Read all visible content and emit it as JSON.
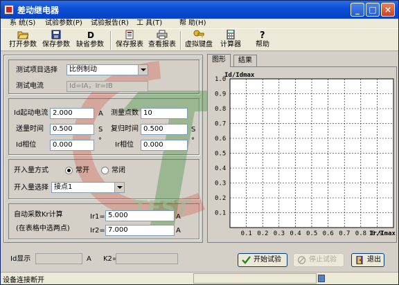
{
  "window": {
    "title": "差动继电器",
    "controls": {
      "minimize": "_",
      "maximize": "□",
      "close": "×"
    }
  },
  "menu": [
    {
      "label": "系 统(S)"
    },
    {
      "label": "试验参数(P)"
    },
    {
      "label": "试验报告(R)"
    },
    {
      "label": "工 具(T)"
    },
    {
      "label": "帮 助(H)"
    }
  ],
  "toolbar": [
    {
      "label": "打开参数",
      "icon": "folder-open-icon"
    },
    {
      "label": "保存参数",
      "icon": "save-icon"
    },
    {
      "label": "缺省参数",
      "icon": "default-icon"
    },
    {
      "label": "保存报表",
      "icon": "report-save-icon"
    },
    {
      "label": "查看报表",
      "icon": "print-icon"
    },
    {
      "label": "虚拟键盘",
      "icon": "key-icon"
    },
    {
      "label": "计算器",
      "icon": "calculator-icon"
    },
    {
      "label": "帮助",
      "icon": "help-icon"
    }
  ],
  "form": {
    "test_item_label": "测试项目选择",
    "test_item_value": "比例制动",
    "test_current_label": "测试电流",
    "test_current_value": "Id=IA，Ir=IB",
    "id_start_label": "Id起动电流",
    "id_start_value": "2.000",
    "id_start_unit": "A",
    "measure_points_label": "测量点数",
    "measure_points_value": "10",
    "send_time_label": "送量时间",
    "send_time_value": "0.500",
    "send_time_unit": "S",
    "reset_time_label": "复归时间",
    "reset_time_value": "0.500",
    "reset_time_unit": "S",
    "id_phase_label": "Id相位",
    "id_phase_value": "0.000",
    "id_phase_unit": "°",
    "ir_phase_label": "Ir相位",
    "ir_phase_value": "0.000",
    "ir_phase_unit": "°",
    "switch_mode_label": "开入量方式",
    "switch_mode_options": [
      "常开",
      "常闭"
    ],
    "switch_mode_selected": "常开",
    "switch_select_label": "开入量选择",
    "switch_select_value": "接点1",
    "auto_calc_label": "自动采数Kr计算",
    "auto_calc_hint": "(在表格中选两点)",
    "ir1_label": "Ir1=",
    "ir1_value": "5.000",
    "ir1_unit": "A",
    "ir2_label": "Ir2=",
    "ir2_value": "7.000",
    "ir2_unit": "A"
  },
  "tabs": [
    {
      "label": "图形",
      "active": true
    },
    {
      "label": "结果",
      "active": false
    }
  ],
  "chart_data": {
    "type": "line",
    "title": "",
    "ylabel": "Id/Idmax",
    "xlabel": "Ir/Imax",
    "x_ticks": [
      "0.1",
      "0.2",
      "0.3",
      "0.4",
      "0.5",
      "0.6",
      "0.7",
      "0.8",
      "0.9"
    ],
    "y_ticks": [
      "0.1",
      "0.2",
      "0.3",
      "0.4",
      "0.5",
      "0.6",
      "0.7",
      "0.8",
      "0.9",
      "1.0"
    ],
    "xlim": [
      0,
      1
    ],
    "ylim": [
      0,
      1
    ],
    "grid": true,
    "series": []
  },
  "bottom": {
    "id_display_label": "Id显示",
    "id_display_value": "",
    "id_display_unit": "A",
    "k2_label": "K2=",
    "k2_value": "",
    "start_button": "开始试验",
    "stop_button": "停止试验",
    "exit_button": "退出"
  },
  "status": {
    "text": "设备连接断开"
  },
  "watermark": {
    "text_en": "TEST",
    "text_cn": "拓普"
  },
  "colors": {
    "title_bar": "#0a4fd6",
    "form_bg": "#d4d0c8",
    "chart_bg": "#ffffff",
    "grid_line": "#000000",
    "watermark_green": "#2f8a2f",
    "watermark_red": "#d83a2a"
  }
}
